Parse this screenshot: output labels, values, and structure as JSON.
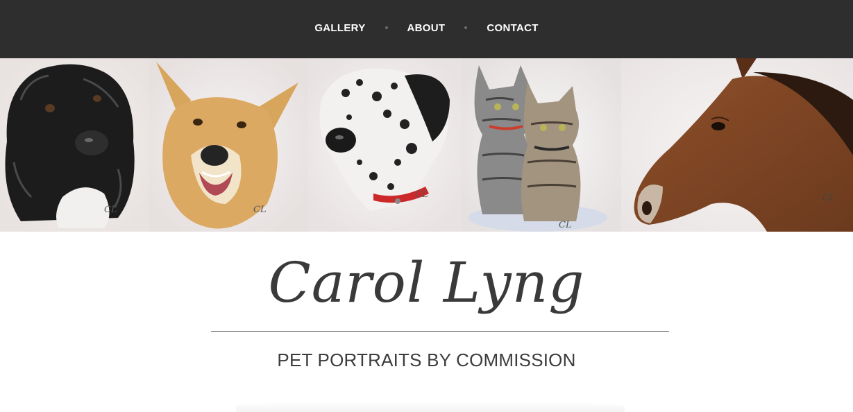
{
  "nav": {
    "items": [
      {
        "label": "GALLERY"
      },
      {
        "label": "ABOUT"
      },
      {
        "label": "CONTACT"
      }
    ]
  },
  "banner": {
    "portraits": [
      {
        "subject": "black-dog"
      },
      {
        "subject": "golden-dog"
      },
      {
        "subject": "dalmatian-great-dane"
      },
      {
        "subject": "two-kittens"
      },
      {
        "subject": "horse"
      }
    ]
  },
  "header": {
    "title": "Carol Lyng",
    "subtitle": "PET PORTRAITS BY COMMISSION"
  },
  "colors": {
    "topbar": "#2e2e2e",
    "text_dark": "#3a3a3a",
    "nav_text": "#ffffff"
  }
}
